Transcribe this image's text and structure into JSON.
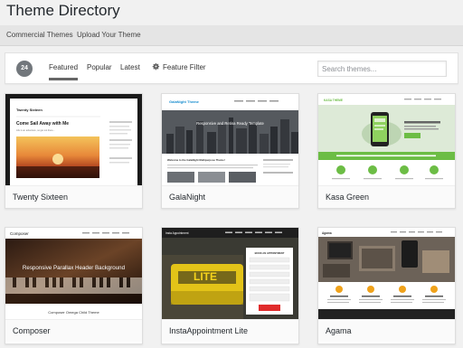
{
  "header": {
    "title": "Theme Directory"
  },
  "subnav": {
    "items": [
      "Commercial Themes",
      "Upload Your Theme"
    ]
  },
  "filters": {
    "count": "24",
    "tabs": [
      "Featured",
      "Popular",
      "Latest"
    ],
    "feature_filter": "Feature Filter",
    "search_placeholder": "Search themes..."
  },
  "themes": [
    {
      "name": "Twenty Sixteen",
      "preview": {
        "site_title": "Twenty Sixteen",
        "post_title": "Come Sail Away with Me",
        "post_excerpt": "Life is an adventure, so get out there..."
      }
    },
    {
      "name": "GalaNight",
      "preview": {
        "logo": "GalaNight Theme",
        "hero_text": "Responsive and Retina Ready Template",
        "welcome": "Welcome to the GalaNight Multipurpose Theme!"
      }
    },
    {
      "name": "Kasa Green",
      "preview": {
        "logo": "KASA THEME"
      }
    },
    {
      "name": "Composer",
      "preview": {
        "logo": "Composer",
        "hero": "Responsive Parallax Header Background",
        "child": "Composer Omega Child Theme"
      }
    },
    {
      "name": "InstaAppointment Lite",
      "preview": {
        "logo": "Insta Appointment",
        "form_title": "BOOK AN APPOINTMENT",
        "lite": "LITE"
      }
    },
    {
      "name": "Agama",
      "preview": {
        "logo": "Agama"
      }
    }
  ]
}
